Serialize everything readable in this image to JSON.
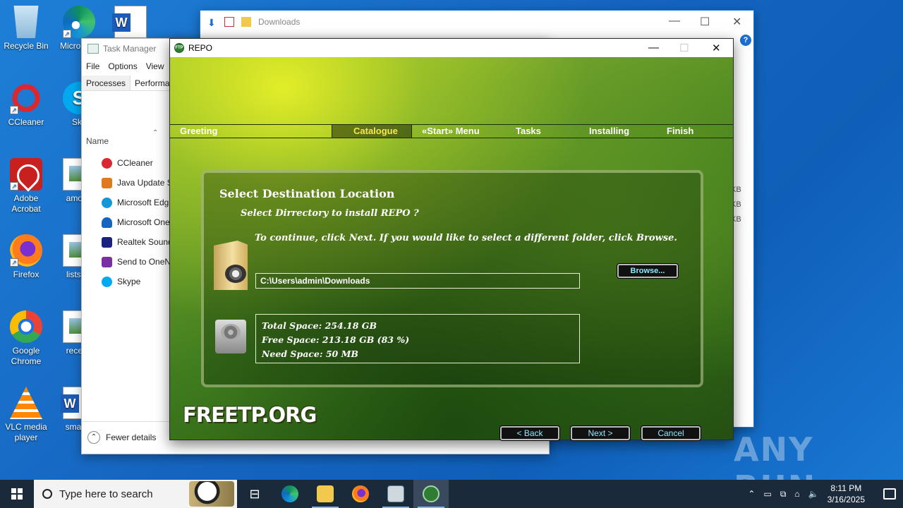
{
  "desktop": {
    "icons": [
      {
        "label": "Recycle Bin",
        "icon": "recycle-bin-icon"
      },
      {
        "label": "Micro Edg",
        "icon": "edge-icon"
      },
      {
        "label": "",
        "icon": "word-icon"
      },
      {
        "label": "CCleaner",
        "icon": "ccleaner-icon"
      },
      {
        "label": "Sky",
        "icon": "skype-icon"
      },
      {
        "label": "Adobe Acrobat",
        "icon": "acrobat-icon"
      },
      {
        "label": "among",
        "icon": "image-file-icon"
      },
      {
        "label": "Firefox",
        "icon": "firefox-icon"
      },
      {
        "label": "listswo",
        "icon": "image-file-icon"
      },
      {
        "label": "Google Chrome",
        "icon": "chrome-icon"
      },
      {
        "label": "recentf",
        "icon": "image-file-icon"
      },
      {
        "label": "VLC media player",
        "icon": "vlc-icon"
      },
      {
        "label": "smaller",
        "icon": "word-icon"
      }
    ]
  },
  "explorer": {
    "title": "Downloads",
    "sizes": [
      "KB",
      "KB",
      "KB"
    ]
  },
  "taskmgr": {
    "title": "Task Manager",
    "menu": [
      "File",
      "Options",
      "View"
    ],
    "tabs": [
      "Processes",
      "Performan"
    ],
    "column": "Name",
    "rows": [
      {
        "name": "CCleaner",
        "color": "#d9282f"
      },
      {
        "name": "Java Update Sc",
        "color": "#e07a1f"
      },
      {
        "name": "Microsoft Edg",
        "color": "#1497d8"
      },
      {
        "name": "Microsoft One",
        "color": "#1565c0"
      },
      {
        "name": "Realtek Sound",
        "color": "#1a237e"
      },
      {
        "name": "Send to OneN",
        "color": "#7b2fa6"
      },
      {
        "name": "Skype",
        "color": "#00a9f0"
      }
    ],
    "footer": "Fewer details"
  },
  "repo": {
    "title": "REPO",
    "app_icon_text": "FTP",
    "steps": [
      "Greeting",
      "Catalogue",
      "«Start» Menu",
      "Tasks",
      "Installing",
      "Finish"
    ],
    "active_step": "Catalogue",
    "heading": "Select Destination Location",
    "subheading": "Select Dirrectory to install REPO ?",
    "instruction": "To continue, click Next. If you would like to select a different folder, click Browse.",
    "path_value": "C:\\Users\\admin\\Downloads",
    "browse_label": "Browse...",
    "total_space": "Total Space: 254.18 GB",
    "free_space": "Free Space: 213.18 GB (83 %)",
    "need_space": "Need Space: 50 MB",
    "logo": "FREETP.ORG",
    "back_label": "< Back",
    "next_label": "Next >",
    "cancel_label": "Cancel"
  },
  "taskbar": {
    "search_placeholder": "Type here to search",
    "time": "8:11 PM",
    "date": "3/16/2025"
  },
  "watermark": "ANY RUN"
}
